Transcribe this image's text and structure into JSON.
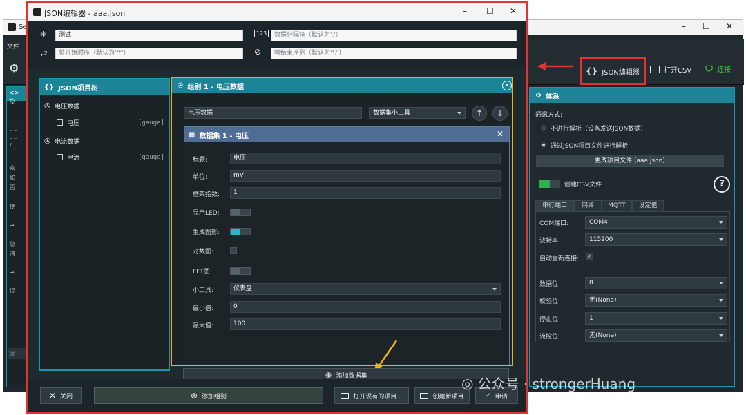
{
  "main_window": {
    "title": "Se",
    "menu": [
      "文件"
    ],
    "toolbar": {
      "json_editor": "JSON编辑器",
      "open_csv": "打开CSV",
      "connect": "连接"
    },
    "left_panel_title": "控",
    "console_lines": [
      "_ _",
      "_ _",
      "_ _",
      "/ _",
      "欢",
      "如",
      "否",
      "使",
      "→",
      "您",
      "请",
      "→",
      "提"
    ],
    "console_input_placeholder": "发"
  },
  "setup": {
    "title": "体系",
    "comm_label": "通讯方式:",
    "option_none": "不进行解析（设备发送JSON数据）",
    "option_json": "通过JSON项目文件进行解析",
    "change_project_btn": "更改项目文件 (aaa.json)",
    "create_csv": "创建CSV文件",
    "tabs": [
      "串行端口",
      "网络",
      "MQTT",
      "设定值"
    ],
    "rows": [
      {
        "label": "COM端口:",
        "value": "COM4"
      },
      {
        "label": "波特率:",
        "value": "115200"
      },
      {
        "label": "自动重新连接:",
        "value": ""
      },
      {
        "label": "数据位:",
        "value": "8"
      },
      {
        "label": "校验位:",
        "value": "无(None)"
      },
      {
        "label": "停止位:",
        "value": "1"
      },
      {
        "label": "流控位:",
        "value": "无(None)"
      }
    ],
    "help_icon": "?"
  },
  "editor": {
    "title": "JSON编辑器 - aaa.json",
    "project_title": "测试",
    "separator_placeholder": "数据分隔符（默认为','）",
    "frame_start_placeholder": "帧开始顺序（默认为'/*'）",
    "frame_end_placeholder": "帧结束序列（默认为'*/'）",
    "tree": {
      "title": "JSON项目树",
      "groups": [
        {
          "name": "电压数据",
          "datasets": [
            {
              "name": "电压",
              "tag": "[gauge]"
            }
          ]
        },
        {
          "name": "电流数据",
          "datasets": [
            {
              "name": "电流",
              "tag": "[gauge]"
            }
          ]
        }
      ]
    },
    "group": {
      "title": "组别 1 - 电压数据",
      "name_value": "电压数据",
      "widget_value": "数据集小工具"
    },
    "dataset": {
      "title": "数据集 1 - 电压",
      "fields": [
        {
          "label": "标题:",
          "value": "电压"
        },
        {
          "label": "单位:",
          "value": "mV"
        },
        {
          "label": "框架指数:",
          "value": "1"
        },
        {
          "label": "显示LED:",
          "value": ""
        },
        {
          "label": "生成图形:",
          "value": ""
        },
        {
          "label": "对数图:",
          "value": ""
        },
        {
          "label": "FFT图:",
          "value": ""
        },
        {
          "label": "小工具:",
          "value": "仪表盘"
        },
        {
          "label": "最小值:",
          "value": "0"
        },
        {
          "label": "最大值:",
          "value": "100"
        }
      ],
      "add_dataset_btn": "添加数据集"
    },
    "bottom": {
      "close": "关闭",
      "add_group": "添加组别",
      "open_existing": "打开现有的项目...",
      "create_new": "创建新项目",
      "apply": "申请"
    }
  },
  "watermark": "公众号 · strongerHuang",
  "colors": {
    "accent": "#1d8396",
    "highlight_red": "#e23232",
    "highlight_yellow": "#f0b21b",
    "toggle_on": "#30b3c4",
    "connect_green": "#3fcf3f"
  }
}
